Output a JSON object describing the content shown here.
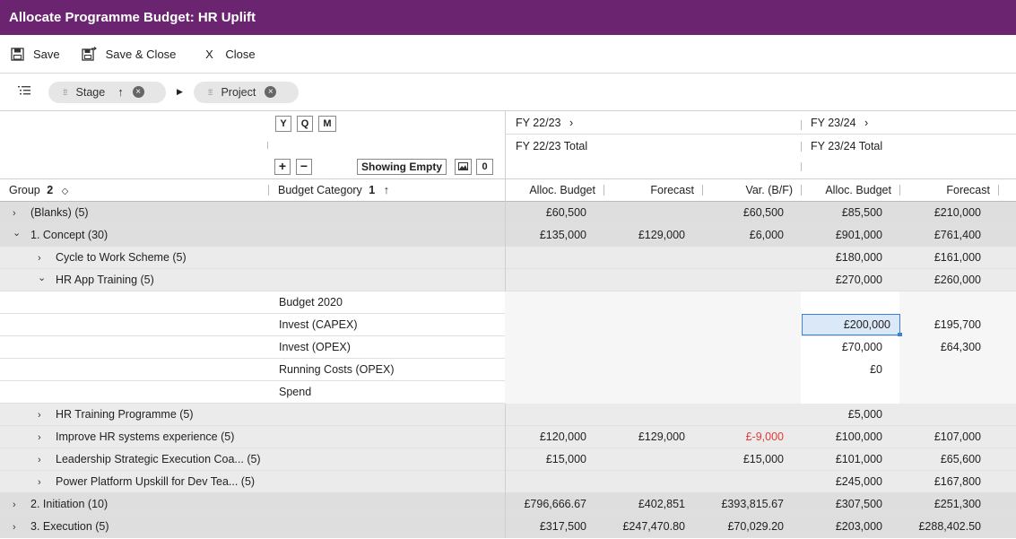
{
  "title": "Allocate Programme Budget: HR Uplift",
  "toolbar": {
    "save": {
      "label": "Save",
      "icon": "save-icon"
    },
    "save_close": {
      "label": "Save & Close",
      "icon": "save-close-icon"
    },
    "close": {
      "label": "Close",
      "icon": "X"
    }
  },
  "grouping": {
    "chips": [
      {
        "label": "Stage",
        "sort": "↑"
      },
      {
        "label": "Project",
        "sort": ""
      }
    ]
  },
  "header": {
    "period_buttons": [
      "Y",
      "Q",
      "M"
    ],
    "showing_empty": "Showing Empty",
    "empty_count": "0",
    "fy1": {
      "label": "FY 22/23",
      "total": "FY 22/23 Total"
    },
    "fy2": {
      "label": "FY 23/24",
      "total": "FY 23/24 Total"
    },
    "group_col": {
      "label": "Group",
      "count": "2"
    },
    "category_col": {
      "label": "Budget Category",
      "count": "1",
      "sort": "↑"
    },
    "columns": [
      "Alloc. Budget",
      "Forecast",
      "Var. (B/F)",
      "Alloc. Budget",
      "Forecast"
    ]
  },
  "rows": [
    {
      "level": 0,
      "expanded": false,
      "group": "(Blanks) (5)",
      "category": "",
      "v": [
        "£60,500",
        "",
        "£60,500",
        "£85,500",
        "£210,000"
      ]
    },
    {
      "level": 0,
      "expanded": true,
      "group": "1. Concept (30)",
      "category": "",
      "v": [
        "£135,000",
        "£129,000",
        "£6,000",
        "£901,000",
        "£761,400"
      ]
    },
    {
      "level": 1,
      "expanded": false,
      "group": "Cycle to Work Scheme (5)",
      "category": "",
      "v": [
        "",
        "",
        "",
        "£180,000",
        "£161,000"
      ]
    },
    {
      "level": 1,
      "expanded": true,
      "group": "HR App Training (5)",
      "category": "",
      "v": [
        "",
        "",
        "",
        "£270,000",
        "£260,000"
      ]
    },
    {
      "level": 2,
      "group": "",
      "category": "Budget 2020",
      "v": [
        "",
        "",
        "",
        "",
        ""
      ]
    },
    {
      "level": 2,
      "group": "",
      "category": "Invest (CAPEX)",
      "v": [
        "",
        "",
        "",
        "£200,000",
        "£195,700"
      ],
      "selected": 3
    },
    {
      "level": 2,
      "group": "",
      "category": "Invest (OPEX)",
      "v": [
        "",
        "",
        "",
        "£70,000",
        "£64,300"
      ]
    },
    {
      "level": 2,
      "group": "",
      "category": "Running Costs (OPEX)",
      "v": [
        "",
        "",
        "",
        "£0",
        ""
      ]
    },
    {
      "level": 2,
      "group": "",
      "category": "Spend",
      "v": [
        "",
        "",
        "",
        "",
        ""
      ]
    },
    {
      "level": 1,
      "expanded": false,
      "group": "HR Training Programme (5)",
      "category": "",
      "v": [
        "",
        "",
        "",
        "£5,000",
        ""
      ]
    },
    {
      "level": 1,
      "expanded": false,
      "group": "Improve HR systems experience (5)",
      "category": "",
      "v": [
        "£120,000",
        "£129,000",
        "£-9,000",
        "£100,000",
        "£107,000"
      ]
    },
    {
      "level": 1,
      "expanded": false,
      "group": "Leadership Strategic Execution Coa...  (5)",
      "category": "",
      "v": [
        "£15,000",
        "",
        "£15,000",
        "£101,000",
        "£65,600"
      ]
    },
    {
      "level": 1,
      "expanded": false,
      "group": "Power Platform Upskill for Dev Tea...  (5)",
      "category": "",
      "v": [
        "",
        "",
        "",
        "£245,000",
        "£167,800"
      ]
    },
    {
      "level": 0,
      "expanded": false,
      "group": "2. Initiation (10)",
      "category": "",
      "v": [
        "£796,666.67",
        "£402,851",
        "£393,815.67",
        "£307,500",
        "£251,300"
      ]
    },
    {
      "level": 0,
      "expanded": false,
      "group": "3. Execution (5)",
      "category": "",
      "v": [
        "£317,500",
        "£247,470.80",
        "£70,029.20",
        "£203,000",
        "£288,402.50"
      ]
    }
  ],
  "colors": {
    "titlebar": "#6b2570",
    "level0_bg": "#dedede",
    "level1_bg": "#ebebeb",
    "leaf_bg": "#ffffff",
    "leaf_data_bg": "#f6f6f6",
    "selected_border": "#3b7fd6",
    "negative": "#e53935"
  }
}
